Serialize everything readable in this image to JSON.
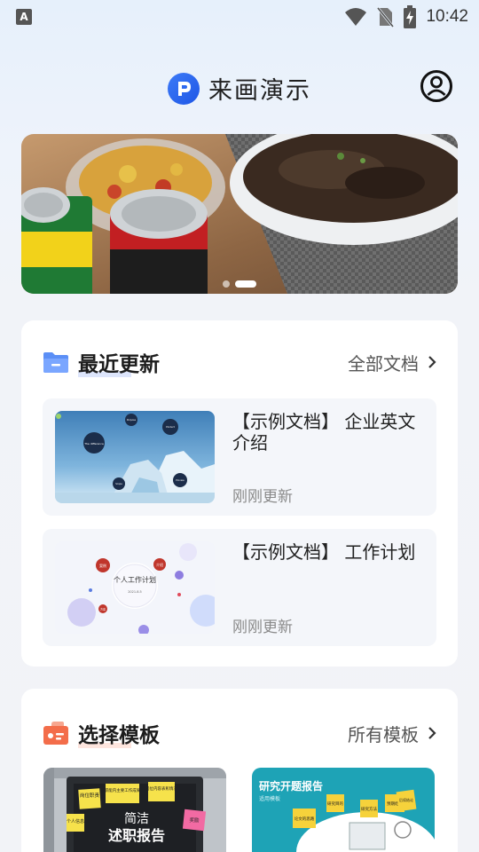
{
  "status_bar": {
    "left_icon_letter": "A",
    "time": "10:42"
  },
  "header": {
    "app_title": "来画演示"
  },
  "banner": {
    "total_slides": 2,
    "active_slide": 2
  },
  "recent": {
    "title": "最近更新",
    "link_label": "全部文档",
    "items": [
      {
        "title": "【示例文档】 企业英文介绍",
        "time": "刚刚更新"
      },
      {
        "title": "【示例文档】 工作计划",
        "time": "刚刚更新"
      }
    ]
  },
  "doc1_thumb": {
    "bubbles": [
      "The difference",
      "Purpose",
      "Product",
      "Scope",
      "Process"
    ]
  },
  "doc2_thumb": {
    "center": "个人工作计划",
    "date": "2021.8.5",
    "labels": [
      "案例",
      "介绍",
      "方案"
    ]
  },
  "templates": {
    "title": "选择模板",
    "link_label": "所有模板",
    "items": [
      {
        "line1": "简洁",
        "line2": "述职报告",
        "notes": [
          "岗位职责",
          "职能内主要工作成果",
          "岗位内容表彰情况",
          "个人信息",
          "奖励"
        ]
      },
      {
        "title": "研究开题报告",
        "subtitle": "适用模板",
        "notes": [
          "研究目的",
          "研究方法",
          "预期结论",
          "论文的思路",
          "后续结论"
        ]
      }
    ]
  },
  "colors": {
    "accent": "#2f6df2",
    "card_bg": "#ffffff",
    "item_bg": "#f4f6fa"
  }
}
